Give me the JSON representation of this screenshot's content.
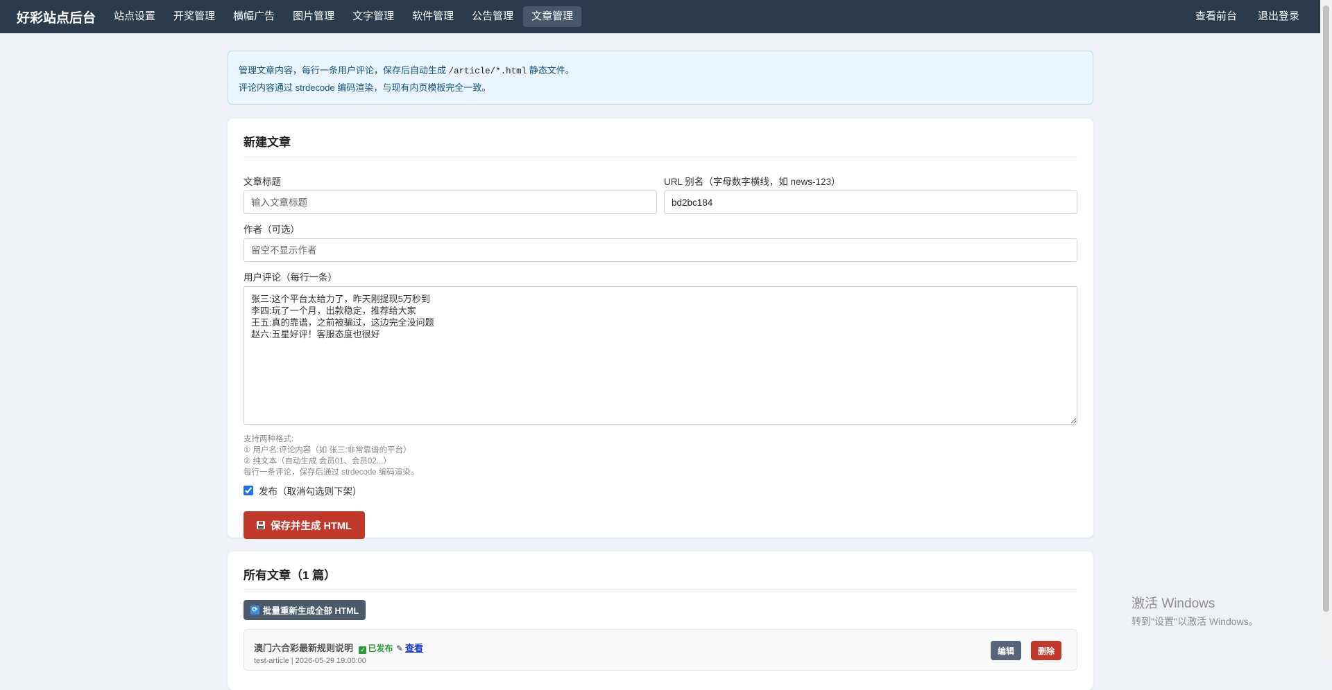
{
  "navbar": {
    "brand": "好彩站点后台",
    "items": [
      {
        "label": "站点设置"
      },
      {
        "label": "开奖管理"
      },
      {
        "label": "横幅广告"
      },
      {
        "label": "图片管理"
      },
      {
        "label": "文字管理"
      },
      {
        "label": "软件管理"
      },
      {
        "label": "公告管理"
      },
      {
        "label": "文章管理",
        "active": true
      }
    ],
    "right": {
      "view_front": "查看前台",
      "logout": "退出登录"
    }
  },
  "info": {
    "line1_pre": "管理文章内容，每行一条用户评论，保存后自动生成",
    "line1_code": "/article/*.html",
    "line1_post": "静态文件。",
    "line2": "评论内容通过 strdecode 编码渲染，与现有内页模板完全一致。"
  },
  "form": {
    "title": "新建文章",
    "article_title_label": "文章标题",
    "article_title_placeholder": "输入文章标题",
    "slug_label": "URL 别名（字母数字横线，如 news-123）",
    "slug_value": "bd2bc184",
    "author_label": "作者（可选）",
    "author_placeholder": "留空不显示作者",
    "comments_label": "用户评论（每行一条）",
    "comments_value": "张三:这个平台太给力了，昨天刚提现5万秒到\n李四:玩了一个月，出款稳定，推荐给大家\n王五:真的靠谱，之前被骗过，这边完全没问题\n赵六:五星好评！客服态度也很好",
    "help_lines": [
      "支持两种格式:",
      "① 用户名:评论内容（如 张三:非常靠谱的平台）",
      "② 纯文本（自动生成 会员01、会员02...）",
      "每行一条评论，保存后通过 strdecode 编码渲染。"
    ],
    "publish_label": "发布（取消勾选则下架）",
    "publish_checked": true,
    "save_button": "保存并生成 HTML"
  },
  "list": {
    "title": "所有文章（1 篇）",
    "regen_button": "批量重新生成全部 HTML",
    "articles": [
      {
        "title": "澳门六合彩最新规则说明",
        "status": "已发布",
        "view": "查看",
        "meta": "test-article | 2026-05-29 19:00:00",
        "edit": "编辑",
        "delete": "删除"
      }
    ]
  },
  "watermark": {
    "title": "激活 Windows",
    "subtitle": "转到\"设置\"以激活 Windows。"
  },
  "colors": {
    "navbar": "#2b3a4d",
    "accent_red": "#c0392b",
    "info_bg": "#eaf4fd",
    "page_bg": "#eef1f5"
  }
}
